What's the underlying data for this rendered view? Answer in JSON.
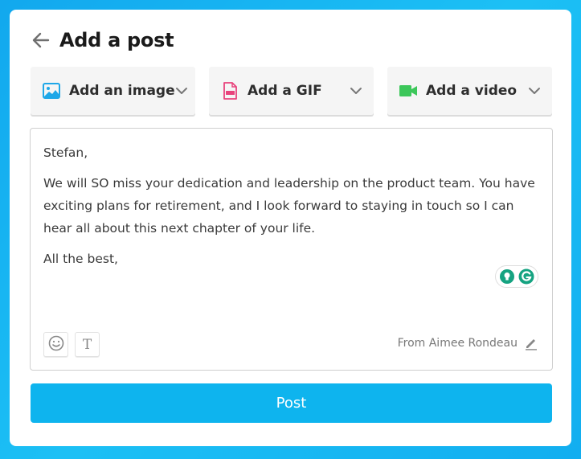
{
  "header": {
    "title": "Add a post"
  },
  "media": {
    "image_label": "Add an image",
    "gif_label": "Add a GIF",
    "video_label": "Add a video"
  },
  "message": {
    "greeting": "Stefan,",
    "body": "We will SO miss your dedication and leadership on the product team. You have exciting plans for retirement, and I look forward to staying in touch so I can hear all about this next chapter of your life.",
    "signoff": "All the best,"
  },
  "footer": {
    "from_text": "From Aimee Rondeau"
  },
  "actions": {
    "post_label": "Post"
  },
  "colors": {
    "background": "#14b4f0",
    "post_button": "#0eb4ee",
    "image_icon": "#1ea7e8",
    "gif_icon": "#e8437c",
    "video_icon": "#3cc75a",
    "grammarly": "#15a381"
  },
  "icons": {
    "back": "back-arrow-icon",
    "image": "image-icon",
    "gif": "gif-file-icon",
    "video": "video-camera-icon",
    "emoji": "emoji-icon",
    "text": "text-format-icon",
    "edit": "pencil-icon",
    "grammarly_suggest": "lightbulb-icon",
    "grammarly": "grammarly-icon"
  }
}
